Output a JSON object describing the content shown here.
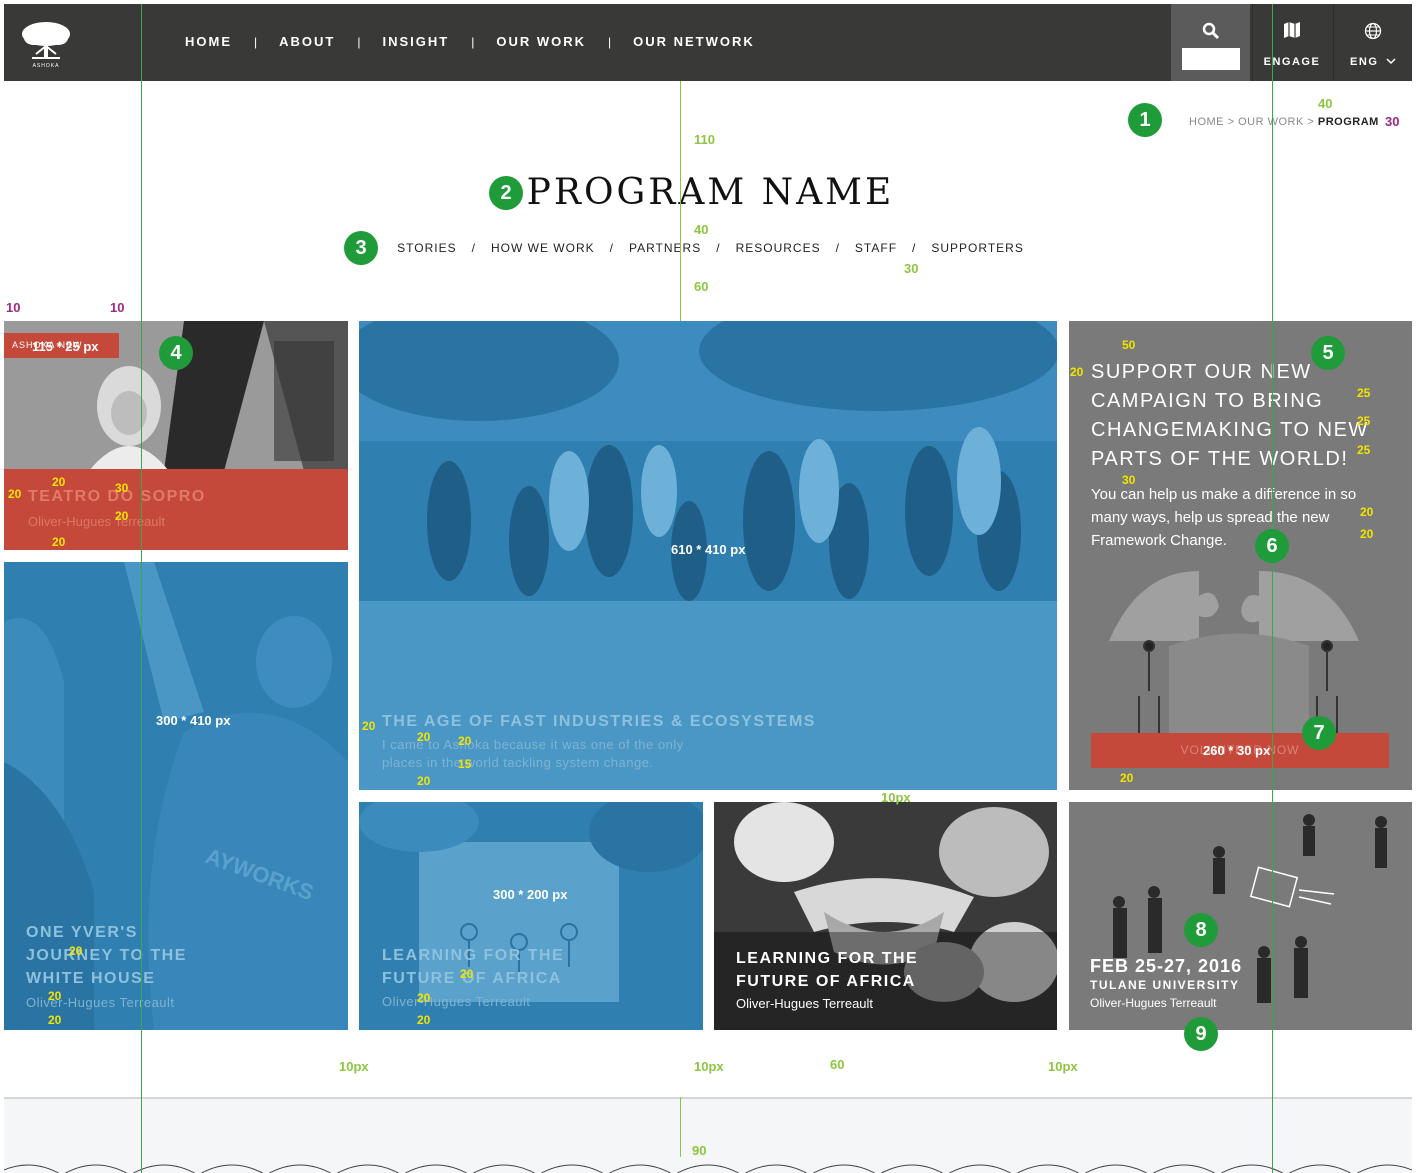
{
  "header": {
    "logo_text": "ASHOKA",
    "nav": [
      "HOME",
      "ABOUT",
      "INSIGHT",
      "OUR WORK",
      "OUR NETWORK"
    ],
    "nav_separator": "|",
    "search_placeholder": "",
    "engage_label": "ENGAGE",
    "lang_label": "ENG",
    "icons": [
      "search-icon",
      "map-icon",
      "globe-icon",
      "chevron-down-icon"
    ]
  },
  "breadcrumb": {
    "home": "HOME",
    "our_work": "OUR WORK",
    "current": "PROGRAM",
    "separator": ">"
  },
  "page_title": "PROGRAM NAME",
  "sub_nav": {
    "items": [
      "STORIES",
      "HOW WE WORK",
      "PARTNERS",
      "RESOURCES",
      "STAFF",
      "SUPPORTERS"
    ],
    "separator": "/"
  },
  "tiles": {
    "t1": {
      "tag": "ASHOKA NEW",
      "title": "TEATRO DO SOPRO",
      "meta": "Oliver-Hugues Terreault",
      "dim": "115 * 25 px"
    },
    "t2": {
      "title": "ONE YVER'S JOURNEY TO THE WHITE HOUSE",
      "meta": "Oliver-Hugues Terreault",
      "dim": "300 * 410 px"
    },
    "t3": {
      "title": "THE AGE OF FAST INDUSTRIES & ECOSYSTEMS",
      "text": "I came to Ashoka because it was one of the only places in the world tackling system change.",
      "dim": "610 * 410 px"
    },
    "t4": {
      "title": "SUPPORT OUR NEW CAMPAIGN TO BRING CHANGEMAKING TO NEW PARTS OF THE WORLD!",
      "text": "You can help us make a difference in so many ways, help us spread the new Framework Change.",
      "button": "VOLUNTEER NOW",
      "dim": "260 * 30 px"
    },
    "t5": {
      "title": "LEARNING FOR THE FUTURE OF AFRICA",
      "meta": "Oliver-Hugues Terreault",
      "dim": "300 * 200 px"
    },
    "t6": {
      "title": "LEARNING FOR THE FUTURE OF AFRICA",
      "meta": "Oliver-Hugues Terreault"
    },
    "t7": {
      "date": "FEB 25-27, 2016",
      "place": "TULANE UNIVERSITY",
      "meta": "Oliver-Hugues Terreault"
    }
  },
  "annotations": {
    "badges": [
      "1",
      "2",
      "3",
      "4",
      "5",
      "6",
      "7",
      "8",
      "9"
    ],
    "spacing_labels": [
      "110",
      "40",
      "60",
      "40",
      "30",
      "30",
      "10",
      "10",
      "50",
      "20",
      "25",
      "25",
      "25",
      "30",
      "20",
      "20",
      "20",
      "20",
      "30",
      "20",
      "20",
      "20",
      "20",
      "20",
      "20",
      "20",
      "15",
      "20",
      "20",
      "20",
      "20",
      "20",
      "20",
      "10px",
      "10px",
      "10px",
      "10px",
      "60",
      "90"
    ]
  },
  "colors": {
    "header_bg": "#393a38",
    "accent_red": "#c5493a",
    "tile_blue": "#2f7fb0",
    "tile_gray": "#7a7a7a",
    "annotation_green": "#8cc63f",
    "annotation_yellow": "#f2e400",
    "annotation_purple": "#a0287f",
    "badge_green": "#1f9b3a"
  }
}
